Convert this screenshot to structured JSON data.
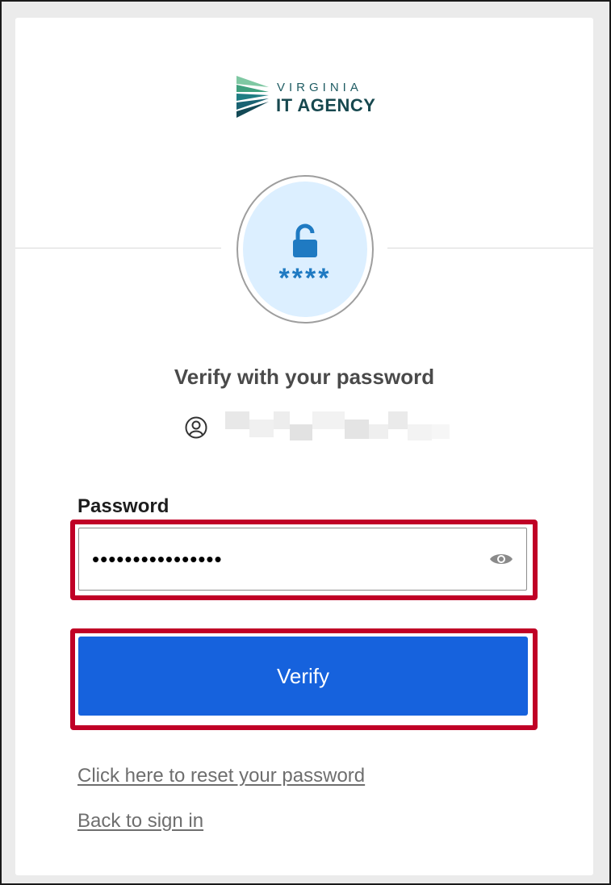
{
  "logo": {
    "line1": "VIRGINIA",
    "line2": "IT AGENCY",
    "color": "#1f5c63"
  },
  "badge": {
    "icon": "padlock-icon",
    "stars": "****"
  },
  "heading": "Verify with your password",
  "user": {
    "icon": "user-circle-icon"
  },
  "form": {
    "password_label": "Password",
    "password_value": "••••••••••••••••",
    "reveal_icon": "eye-icon",
    "verify_label": "Verify"
  },
  "links": {
    "reset": "Click here to reset your password",
    "back": "Back to sign in"
  },
  "colors": {
    "primary": "#1662dd",
    "highlight": "#c00026",
    "badge_bg": "#dcefff"
  }
}
